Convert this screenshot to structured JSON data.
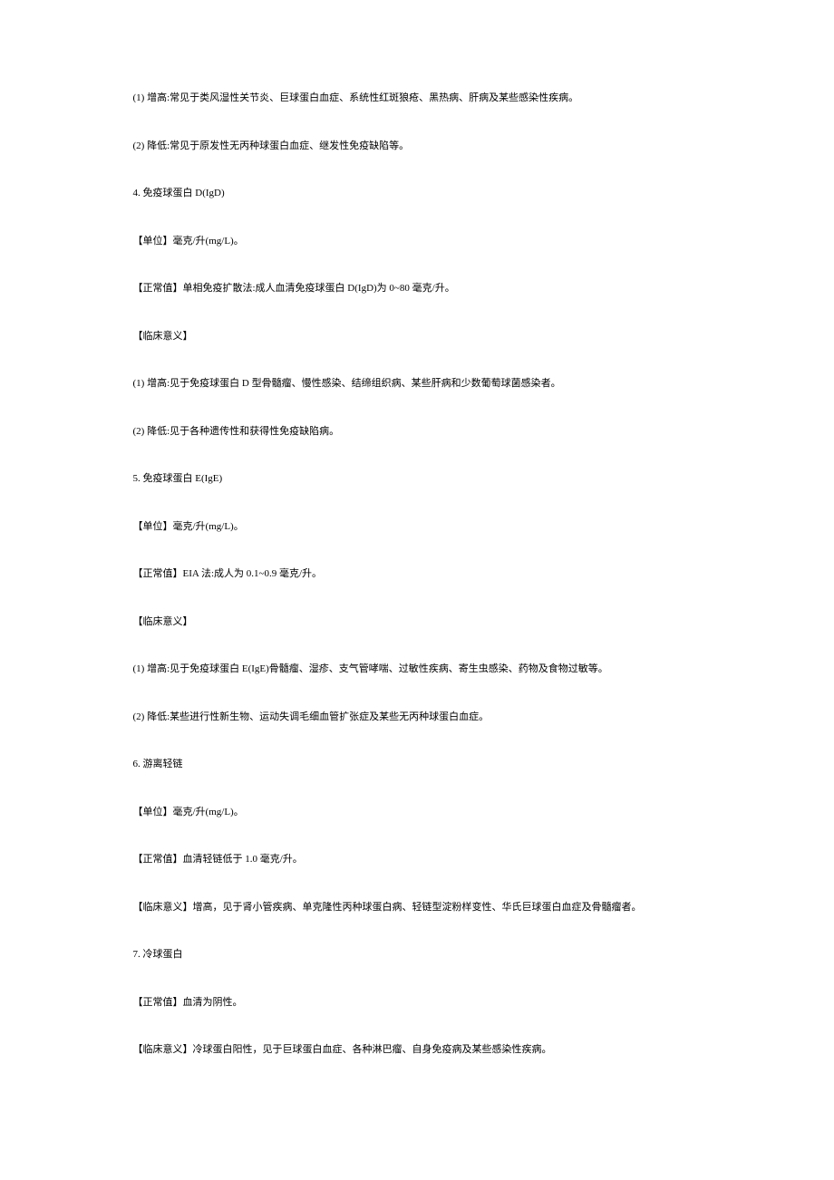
{
  "lines": [
    "(1) 增高:常见于类风湿性关节炎、巨球蛋白血症、系统性红斑狼疮、黑热病、肝病及某些感染性疾病。",
    "(2) 降低:常见于原发性无丙种球蛋白血症、继发性免疫缺陷等。",
    "4. 免疫球蛋白 D(IgD)",
    "【单位】毫克/升(mg/L)。",
    "【正常值】单相免疫扩散法:成人血清免疫球蛋白 D(IgD)为 0~80 毫克/升。",
    "【临床意义】",
    "(1) 增高:见于免疫球蛋白 D 型骨髓瘤、慢性感染、结缔组织病、某些肝病和少数葡萄球菌感染者。",
    "(2) 降低:见于各种遗传性和获得性免疫缺陷病。",
    "5. 免疫球蛋白 E(IgE)",
    "【单位】毫克/升(mg/L)。",
    "【正常值】EIA 法:成人为 0.1~0.9 毫克/升。",
    "【临床意义】",
    "(1) 增高:见于免疫球蛋白 E(IgE)骨髓瘤、湿疹、支气管哮喘、过敏性疾病、寄生虫感染、药物及食物过敏等。",
    "(2) 降低:某些进行性新生物、运动失调毛细血管扩张症及某些无丙种球蛋白血症。",
    "6. 游离轻链",
    "【单位】毫克/升(mg/L)。",
    "【正常值】血清轻链低于 1.0 毫克/升。",
    "【临床意义】增高，见于肾小管疾病、单克隆性丙种球蛋白病、轻链型淀粉样变性、华氏巨球蛋白血症及骨髓瘤者。",
    "7. 冷球蛋白",
    "【正常值】血清为阴性。",
    "【临床意义】冷球蛋白阳性，见于巨球蛋白血症、各种淋巴瘤、自身免疫病及某些感染性疾病。"
  ]
}
